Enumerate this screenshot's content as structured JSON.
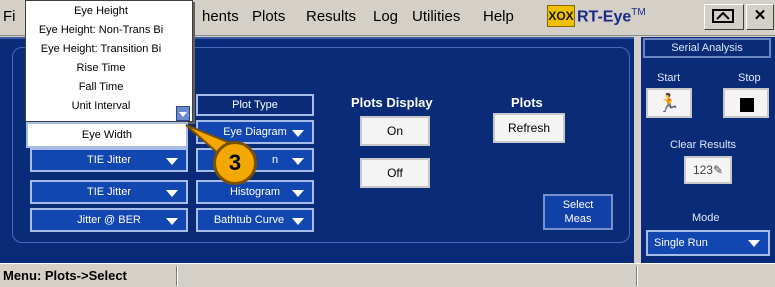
{
  "menubar": {
    "partial_file": "Fi",
    "items": [
      "hents",
      "Plots",
      "Results",
      "Log",
      "Utilities",
      "Help"
    ],
    "logo": "XOX",
    "app_title": "RT-Eye",
    "trademark": "TM"
  },
  "dropdown": {
    "items": [
      "Eye Height",
      "Eye Height: Non-Trans Bi",
      "Eye Height: Transition Bi",
      "Rise Time",
      "Fall Time",
      "Unit Interval"
    ],
    "selected": "Eye Width"
  },
  "measurements": {
    "rows": [
      {
        "measure": "TIE Jitter",
        "plot": "n"
      },
      {
        "measure": "TIE Jitter",
        "plot": "Histogram"
      },
      {
        "measure": "Jitter @ BER",
        "plot": "Bathtub Curve"
      }
    ],
    "plot_type_header": "Plot Type",
    "first_plot": "Eye Diagram",
    "select_meas": [
      "Select",
      "Meas"
    ]
  },
  "plots_display": {
    "title": "Plots Display",
    "on_label": "On",
    "off_label": "Off"
  },
  "plots": {
    "title": "Plots",
    "refresh_label": "Refresh"
  },
  "right_panel": {
    "title": "Serial Analysis",
    "start_label": "Start",
    "stop_label": "Stop",
    "clear_results_label": "Clear Results",
    "mode_label": "Mode",
    "mode_value": "Single Run"
  },
  "callout": {
    "number": "3"
  },
  "statusbar": {
    "text": "Menu: Plots->Select"
  }
}
